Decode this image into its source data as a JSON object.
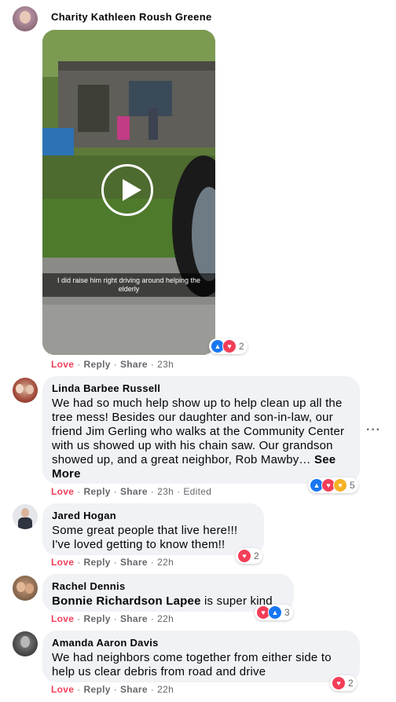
{
  "comments": [
    {
      "author": "Charity Kathleen Roush Greene",
      "video_caption": "I did raise him right driving around helping the elderly",
      "actions": {
        "love": "Love",
        "reply": "Reply",
        "share": "Share",
        "time": "23h"
      },
      "reaction_count": "2",
      "reaction_icons": [
        "like-icon",
        "love-icon"
      ]
    },
    {
      "author": "Linda Barbee Russell",
      "text": "We had so much help show up to help clean up all the tree mess! Besides our daughter and son-in-law, our friend Jim Gerling who walks at the Community Center with us showed up with his chain saw. Our grandson showed up, and a great neighbor, Rob Mawby…",
      "see_more": "See More",
      "actions": {
        "love": "Love",
        "reply": "Reply",
        "share": "Share",
        "time": "23h",
        "edited": "Edited"
      },
      "reaction_count": "5",
      "reaction_icons": [
        "like-icon",
        "love-icon",
        "care-icon"
      ]
    },
    {
      "author": "Jared Hogan",
      "text": "Some great people that live here!!!\nI've loved getting to know them!!",
      "actions": {
        "love": "Love",
        "reply": "Reply",
        "share": "Share",
        "time": "22h"
      },
      "reaction_count": "2",
      "reaction_icons": [
        "love-icon"
      ]
    },
    {
      "author": "Rachel Dennis",
      "mention": "Bonnie Richardson Lapee",
      "text": "is super kind",
      "actions": {
        "love": "Love",
        "reply": "Reply",
        "share": "Share",
        "time": "22h"
      },
      "reaction_count": "3",
      "reaction_icons": [
        "love-icon",
        "like-icon"
      ]
    },
    {
      "author": "Amanda Aaron Davis",
      "text": "We had neighbors come together from either side to help us clear debris from road and drive",
      "actions": {
        "love": "Love",
        "reply": "Reply",
        "share": "Share",
        "time": "22h"
      },
      "reaction_count": "2",
      "reaction_icons": [
        "love-icon"
      ]
    }
  ],
  "more_options_icon": "more-horizontal-icon",
  "colors": {
    "love": "#f33e58",
    "like": "#1877f2",
    "bubble": "#f0f2f5",
    "meta": "#65676b"
  }
}
